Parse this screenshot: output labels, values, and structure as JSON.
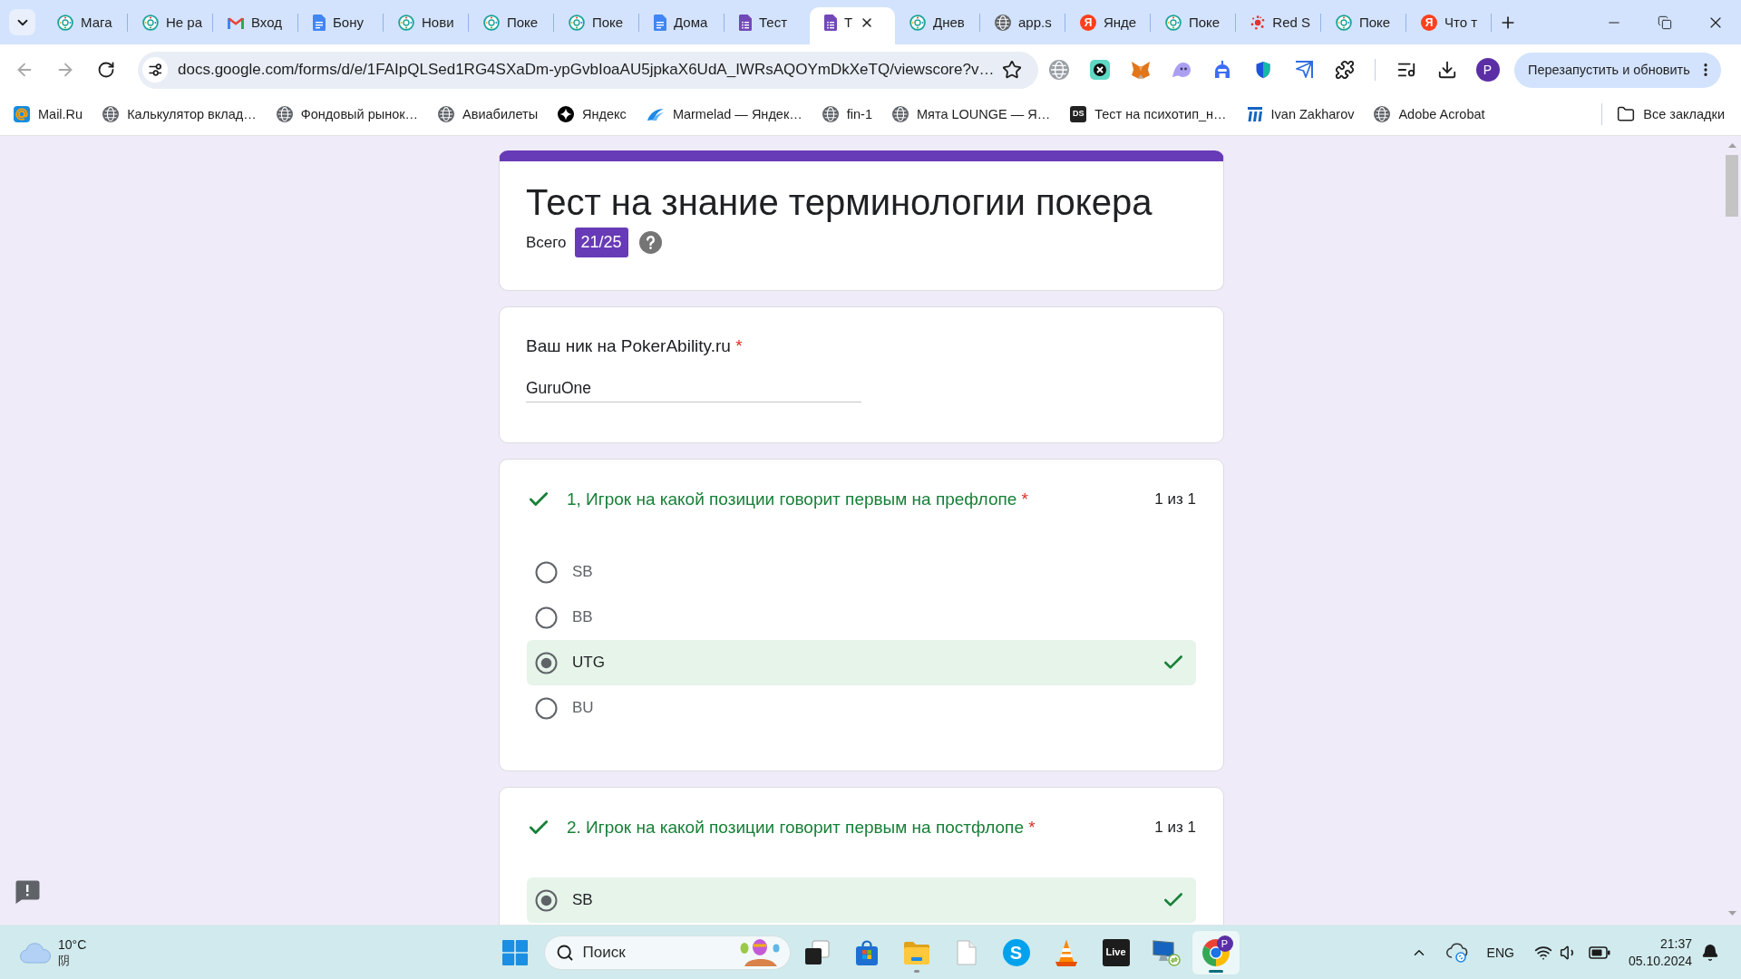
{
  "browser": {
    "tabs": [
      {
        "title": "Мага",
        "kind": "poker",
        "selected": false
      },
      {
        "title": "Не ра",
        "kind": "poker",
        "selected": false
      },
      {
        "title": "Вход",
        "kind": "gmail",
        "selected": false
      },
      {
        "title": "Бону",
        "kind": "docs",
        "selected": false
      },
      {
        "title": "Нови",
        "kind": "poker",
        "selected": false
      },
      {
        "title": "Поке",
        "kind": "poker",
        "selected": false
      },
      {
        "title": "Поке",
        "kind": "poker",
        "selected": false
      },
      {
        "title": "Дома",
        "kind": "docs",
        "selected": false
      },
      {
        "title": "Тест",
        "kind": "forms",
        "selected": false
      },
      {
        "title": "Т",
        "kind": "forms",
        "selected": true
      },
      {
        "title": "Днев",
        "kind": "poker",
        "selected": false
      },
      {
        "title": "app.s",
        "kind": "globe",
        "selected": false
      },
      {
        "title": "Янде",
        "kind": "yandex",
        "icon_text": "Я",
        "selected": false
      },
      {
        "title": "Поке",
        "kind": "poker",
        "selected": false
      },
      {
        "title": "Red S",
        "kind": "splash",
        "selected": false
      },
      {
        "title": "Поке",
        "kind": "poker",
        "selected": false
      },
      {
        "title": "Что т",
        "kind": "yandex",
        "icon_text": "Я",
        "selected": false
      }
    ],
    "nav": {
      "back_disabled": true,
      "forward_disabled": true
    },
    "url": "docs.google.com/forms/d/e/1FAIpQLSed1RG4SXaDm-ypGvbIoaAU5jpkaX6UdA_IWRsAQOYmDkXeTQ/viewscore?v…",
    "profile_initial": "P",
    "update_button": "Перезапустить и обновить",
    "bookmarks": [
      {
        "label": "Mail.Ru",
        "kind": "mail"
      },
      {
        "label": "Калькулятор вклад…",
        "kind": "globe"
      },
      {
        "label": "Фондовый рынок…",
        "kind": "globe"
      },
      {
        "label": "Авиабилеты",
        "kind": "globe"
      },
      {
        "label": "Яндекс",
        "kind": "sparkle"
      },
      {
        "label": "Marmelad — Яндек…",
        "kind": "wing"
      },
      {
        "label": "fin-1",
        "kind": "globe"
      },
      {
        "label": "Мята LOUNGE — Я…",
        "kind": "globe"
      },
      {
        "label": "Тест на психотип_н…",
        "kind": "text",
        "icon_text": "DS"
      },
      {
        "label": "Ivan Zakharov",
        "kind": "logo"
      },
      {
        "label": "Adobe Acrobat",
        "kind": "globe"
      }
    ],
    "all_bookmarks": "Все закладки"
  },
  "form": {
    "title": "Тест на знание терминологии покера",
    "score_label": "Всего",
    "score": "21/25",
    "nickname": {
      "label": "Ваш ник на PokerAbility.ru",
      "required_mark": "*",
      "value": "GuruOne"
    },
    "questions": [
      {
        "text": "1, Игрок на какой позиции говорит первым на префлопе",
        "required_mark": "*",
        "correct": true,
        "points": "1 из 1",
        "options": [
          {
            "label": "SB",
            "selected": false
          },
          {
            "label": "BB",
            "selected": false
          },
          {
            "label": "UTG",
            "selected": true
          },
          {
            "label": "BU",
            "selected": false
          }
        ]
      },
      {
        "text": "2. Игрок на какой позиции говорит первым на постфлопе",
        "required_mark": "*",
        "correct": true,
        "points": "1 из 1",
        "options": [
          {
            "label": "SB",
            "selected": true
          }
        ]
      }
    ]
  },
  "taskbar": {
    "weather": {
      "temperature": "10°C",
      "condition": "阴"
    },
    "search": {
      "placeholder": "Поиск"
    },
    "apps": [
      {
        "kind": "task-view",
        "running": false,
        "active": false
      },
      {
        "kind": "store",
        "running": false,
        "active": false
      },
      {
        "kind": "explorer",
        "running": true,
        "active": false
      },
      {
        "kind": "file",
        "running": false,
        "active": false
      },
      {
        "kind": "skype",
        "label": "S",
        "running": false,
        "active": false
      },
      {
        "kind": "vlc",
        "running": false,
        "active": false
      },
      {
        "kind": "live",
        "label": "Live",
        "running": false,
        "active": false
      },
      {
        "kind": "remote",
        "running": false,
        "active": false
      },
      {
        "kind": "chrome",
        "badge": "P",
        "running": true,
        "active": true
      }
    ],
    "language": "ENG",
    "time": "21:37",
    "date": "05.10.2024"
  }
}
